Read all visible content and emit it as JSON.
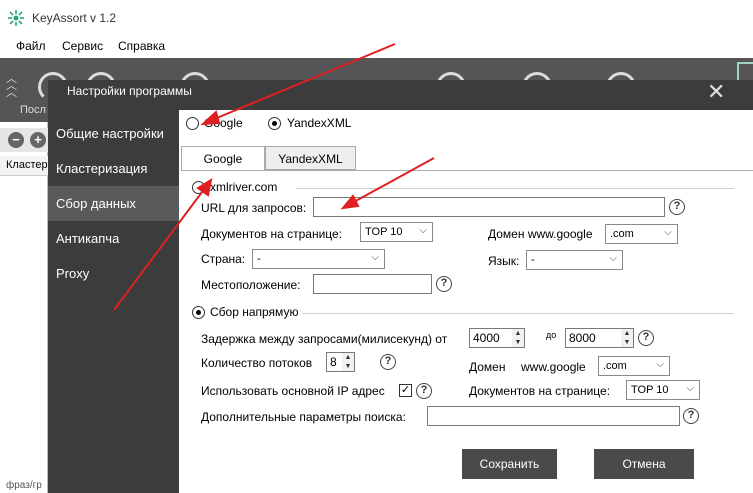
{
  "app": {
    "title": "KeyAssort v 1.2"
  },
  "menu": [
    "Файл",
    "Сервис",
    "Справка"
  ],
  "toolbar": {
    "label": "Посл"
  },
  "leftpane": {
    "header": "Кластер",
    "footer": "фраз/гр"
  },
  "dialog": {
    "title": "Настройки программы",
    "nav": [
      {
        "label": "Общие настройки",
        "active": false
      },
      {
        "label": "Кластеризация",
        "active": false
      },
      {
        "label": "Сбор данных",
        "active": true
      },
      {
        "label": "Антикапча",
        "active": false
      },
      {
        "label": "Proxy",
        "active": false
      }
    ],
    "source": {
      "google": "Google",
      "yandex": "YandexXML",
      "selected": "YandexXML"
    },
    "tabs": [
      {
        "label": "Google",
        "active": true
      },
      {
        "label": "YandexXML",
        "active": false
      }
    ],
    "xmlriver": {
      "radio_label": "xmlriver.com",
      "url_label": "URL для запросов:",
      "url_value": "",
      "docs_label": "Документов на странице:",
      "docs_value": "TOP 10",
      "domain_label": "Домен www.google",
      "domain_value": ".com",
      "country_label": "Страна:",
      "country_value": "-",
      "lang_label": "Язык:",
      "lang_value": "-",
      "location_label": "Местоположение:",
      "location_value": ""
    },
    "direct": {
      "radio_label": "Сбор напрямую",
      "delay_label": "Задержка между запросами(милисекунд) от",
      "delay_from": "4000",
      "delay_to_label": "до",
      "delay_to": "8000",
      "threads_label": "Количество потоков",
      "threads_value": "8",
      "domain_label": "Домен",
      "domain_prefix": "www.google",
      "domain_value": ".com",
      "ip_label": "Использовать основной IP адрес",
      "ip_checked": true,
      "docs_label": "Документов на странице:",
      "docs_value": "TOP 10",
      "extra_label": "Дополнительные параметры поиска:",
      "extra_value": ""
    },
    "buttons": {
      "save": "Сохранить",
      "cancel": "Отмена"
    }
  },
  "colors": {
    "dialog_bg": "#3c3c3c",
    "nav_active": "#5a5a5a",
    "arrow": "#e02020",
    "toolbar_bg": "#555558"
  }
}
